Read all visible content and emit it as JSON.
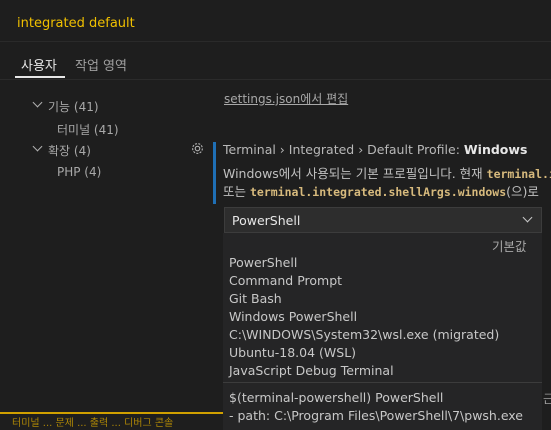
{
  "search": {
    "query": "integrated default"
  },
  "tabs": [
    {
      "label": "사용자"
    },
    {
      "label": "작업 영역"
    }
  ],
  "tree": {
    "items": [
      {
        "label": "기능 (41)"
      },
      {
        "label": "터미널 (41)"
      },
      {
        "label": "확장 (4)"
      },
      {
        "label": "PHP (4)"
      }
    ]
  },
  "edit_link": "settings.json에서 편집",
  "setting": {
    "title_prefix": "Terminal › Integrated › Default Profile: ",
    "title_name": "Windows",
    "desc_line1_text": "Windows에서 사용되는 기본 프로필입니다. 현재 ",
    "desc_line1_code": "terminal.integrated.shell.windows",
    "desc_line2_prefix": "또는 ",
    "desc_line2_code": "terminal.integrated.shellArgs.windows",
    "desc_line2_suffix": "(으)로"
  },
  "select": {
    "value": "PowerShell",
    "default_label": "기본값",
    "options": [
      "PowerShell",
      "Command Prompt",
      "Git Bash",
      "Windows PowerShell",
      "C:\\WINDOWS\\System32\\wsl.exe (migrated)",
      "Ubuntu-18.04 (WSL)",
      "JavaScript Debug Terminal"
    ],
    "detail_line1": "$(terminal-powershell) PowerShell",
    "detail_line2": "- path: C:\\Program Files\\PowerShell\\7\\pwsh.exe"
  },
  "right_edge_text": "근",
  "bottom_strip_text": "터미널 ... 문제 ... 출력 ... 디버그 콘솔"
}
